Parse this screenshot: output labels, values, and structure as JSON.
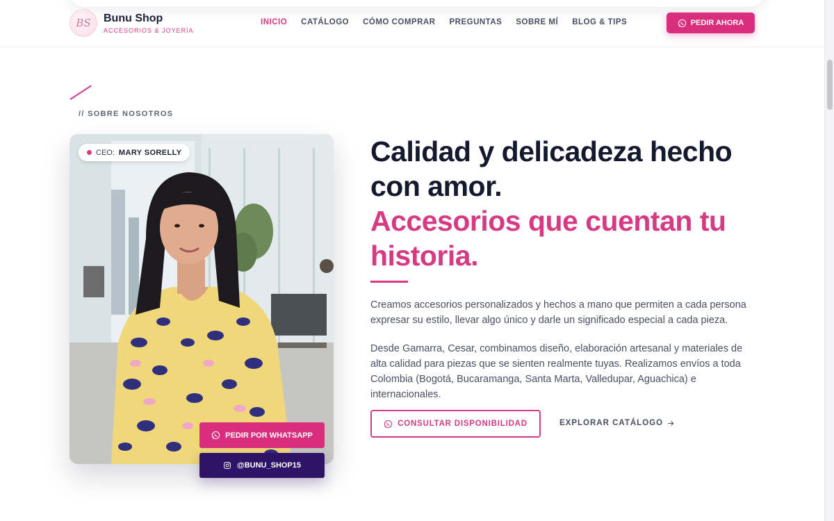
{
  "brand": {
    "name": "Bunu Shop",
    "tagline": "ACCESORIOS & JOYERÍA",
    "logo_initials": "BS"
  },
  "nav": {
    "items": [
      {
        "label": "INICIO",
        "active": true
      },
      {
        "label": "CATÁLOGO",
        "active": false
      },
      {
        "label": "CÓMO COMPRAR",
        "active": false
      },
      {
        "label": "PREGUNTAS",
        "active": false
      },
      {
        "label": "SOBRE MÍ",
        "active": false
      },
      {
        "label": "BLOG & TIPS",
        "active": false
      }
    ],
    "cta_label": "PEDIR AHORA"
  },
  "about": {
    "section_label": "// SOBRE NOSOTROS",
    "ceo_prefix": "CEO:",
    "ceo_name": "MARY SORELLY",
    "headline_line1": "Calidad y delicadeza hecho con amor.",
    "headline_line2": "Accesorios que cuentan tu historia.",
    "paragraph1": "Creamos accesorios personalizados y hechos a mano que permiten a cada persona expresar su estilo, llevar algo único y darle un significado especial a cada pieza.",
    "paragraph2": "Desde Gamarra, Cesar, combinamos diseño, elaboración artesanal y materiales de alta calidad para piezas que se sienten realmente tuyas. Realizamos envíos a toda Colombia (Bogotá, Bucaramanga, Santa Marta, Valledupar, Aguachica) e internacionales.",
    "whatsapp_label": "PEDIR POR WHATSAPP",
    "instagram_label": "@BUNU_SHOP15",
    "consultar_label": "CONSULTAR DISPONIBILIDAD",
    "explorar_label": "EXPLORAR CATÁLOGO"
  },
  "colors": {
    "accent": "#d63a83",
    "dark": "#15192e",
    "instagram_bg": "#2e1468"
  },
  "icons": [
    "whatsapp-icon",
    "instagram-icon",
    "arrow-right-icon"
  ]
}
